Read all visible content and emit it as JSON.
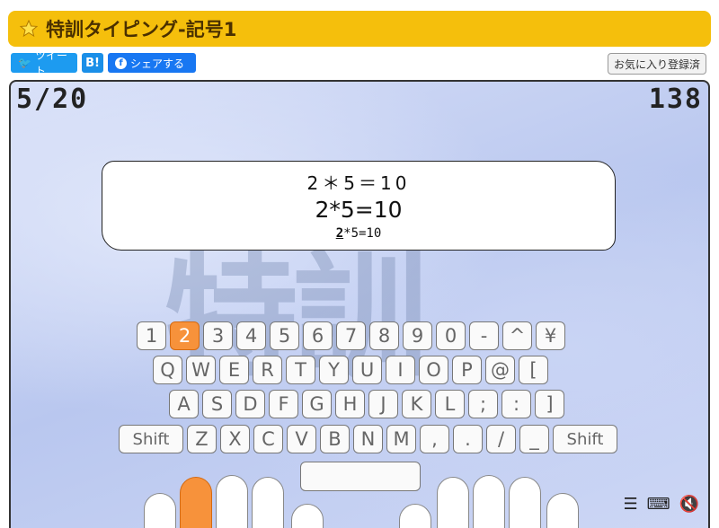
{
  "title": "特訓タイピング-記号1",
  "icons": {
    "title": "star-icon"
  },
  "social": {
    "tweet": "ツイート",
    "hatena": "B!",
    "facebook": "シェアする"
  },
  "favorite": "お気に入り登録済",
  "game": {
    "progress": "5/20",
    "score": "138",
    "watermark": "特訓",
    "question_display": "2＊5＝10",
    "question_text": "2*5=10",
    "typed": "2",
    "remaining": "*5=10"
  },
  "keyboard": {
    "row1": [
      "1",
      "2",
      "3",
      "4",
      "5",
      "6",
      "7",
      "8",
      "9",
      "0",
      "-",
      "^",
      "¥"
    ],
    "row2": [
      "Q",
      "W",
      "E",
      "R",
      "T",
      "Y",
      "U",
      "I",
      "O",
      "P",
      "@",
      "["
    ],
    "row3": [
      "A",
      "S",
      "D",
      "F",
      "G",
      "H",
      "J",
      "K",
      "L",
      ";",
      ":",
      "]"
    ],
    "row4": [
      "Shift",
      "Z",
      "X",
      "C",
      "V",
      "B",
      "N",
      "M",
      ",",
      ".",
      "/",
      "_",
      "Shift"
    ],
    "active_key": "2"
  }
}
